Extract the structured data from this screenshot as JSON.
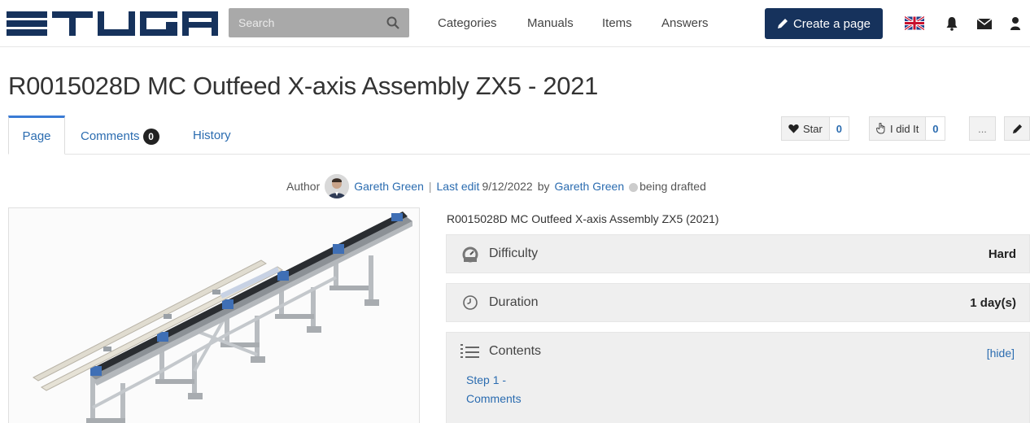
{
  "brand": {
    "logo_text": "STUGA"
  },
  "search": {
    "placeholder": "Search"
  },
  "nav": {
    "links": [
      "Categories",
      "Manuals",
      "Items",
      "Answers"
    ],
    "create_label": "Create a page"
  },
  "page": {
    "title": "R0015028D MC Outfeed X-axis Assembly ZX5 - 2021",
    "tabs": {
      "page": "Page",
      "comments": "Comments",
      "comments_count": "0",
      "history": "History"
    },
    "actions": {
      "star_label": "Star",
      "star_count": "0",
      "ididit_label": "I did It",
      "ididit_count": "0",
      "more_label": "..."
    }
  },
  "meta": {
    "author_label": "Author",
    "author_name": "Gareth Green",
    "separator": "|",
    "last_edit_label": "Last edit",
    "last_edit_date": "9/12/2022",
    "by_label": "by",
    "editor_name": "Gareth Green",
    "status": "being drafted"
  },
  "details": {
    "subtitle": "R0015028D MC Outfeed X-axis Assembly ZX5 (2021)",
    "difficulty_label": "Difficulty",
    "difficulty_value": "Hard",
    "duration_label": "Duration",
    "duration_value": "1 day(s)",
    "contents_label": "Contents",
    "hide_label": "[hide]",
    "toc": [
      "Step 1 -",
      "Comments"
    ]
  },
  "colors": {
    "primary": "#16325c",
    "link": "#2b6cb0",
    "tab_accent": "#3a7bd5",
    "search_bg": "#a9a9a9",
    "infobox_bg": "#efefef"
  }
}
